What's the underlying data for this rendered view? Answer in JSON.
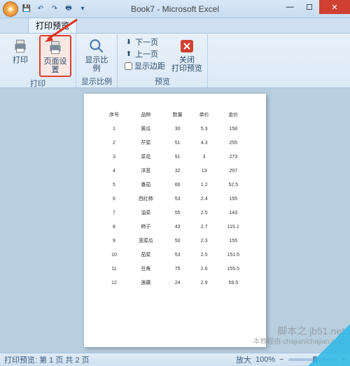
{
  "titlebar": {
    "title": "Book7 - Microsoft Excel"
  },
  "tab": {
    "label": "打印预览"
  },
  "ribbon": {
    "print_group": {
      "label": "打印",
      "print_btn": "打印",
      "page_setup_btn": "页面设置"
    },
    "zoom_group": {
      "label": "显示比例",
      "zoom_btn": "显示比例"
    },
    "preview_group": {
      "label": "预览",
      "next_page": "下一页",
      "prev_page": "上一页",
      "show_margins": "显示边距",
      "close_btn": "关闭\n打印预览"
    }
  },
  "page": {
    "headers": [
      "序号",
      "品种",
      "数量",
      "单价",
      "金价"
    ],
    "rows": [
      [
        "1",
        "黄瓜",
        "30",
        "5.3",
        "158"
      ],
      [
        "2",
        "芹菜",
        "51",
        "4.3",
        "255"
      ],
      [
        "3",
        "菜花",
        "91",
        "3",
        "273"
      ],
      [
        "4",
        "洋葱",
        "32",
        "13",
        "297"
      ],
      [
        "5",
        "番茄",
        "66",
        "1.2",
        "52.5"
      ],
      [
        "6",
        "西红柿",
        "53",
        "2.4",
        "155"
      ],
      [
        "7",
        "油菜",
        "55",
        "2.5",
        "143"
      ],
      [
        "8",
        "柿子",
        "43",
        "2.7",
        "115.1"
      ],
      [
        "9",
        "菠菜瓜",
        "50",
        "2.3",
        "155"
      ],
      [
        "10",
        "茄菜",
        "53",
        "2.5",
        "151.5"
      ],
      [
        "11",
        "豆角",
        "75",
        "2.6",
        "155.5"
      ],
      [
        "12",
        "莲藕",
        "24",
        "2.9",
        "59.5"
      ]
    ]
  },
  "statusbar": {
    "left": "打印预览: 第 1 页  共 2 页",
    "zoom_label": "放大",
    "zoom_pct": "100%"
  },
  "watermark": {
    "line1": "脚本之 jb51.net",
    "line2": "本教程由 chajian/chajian.com"
  }
}
